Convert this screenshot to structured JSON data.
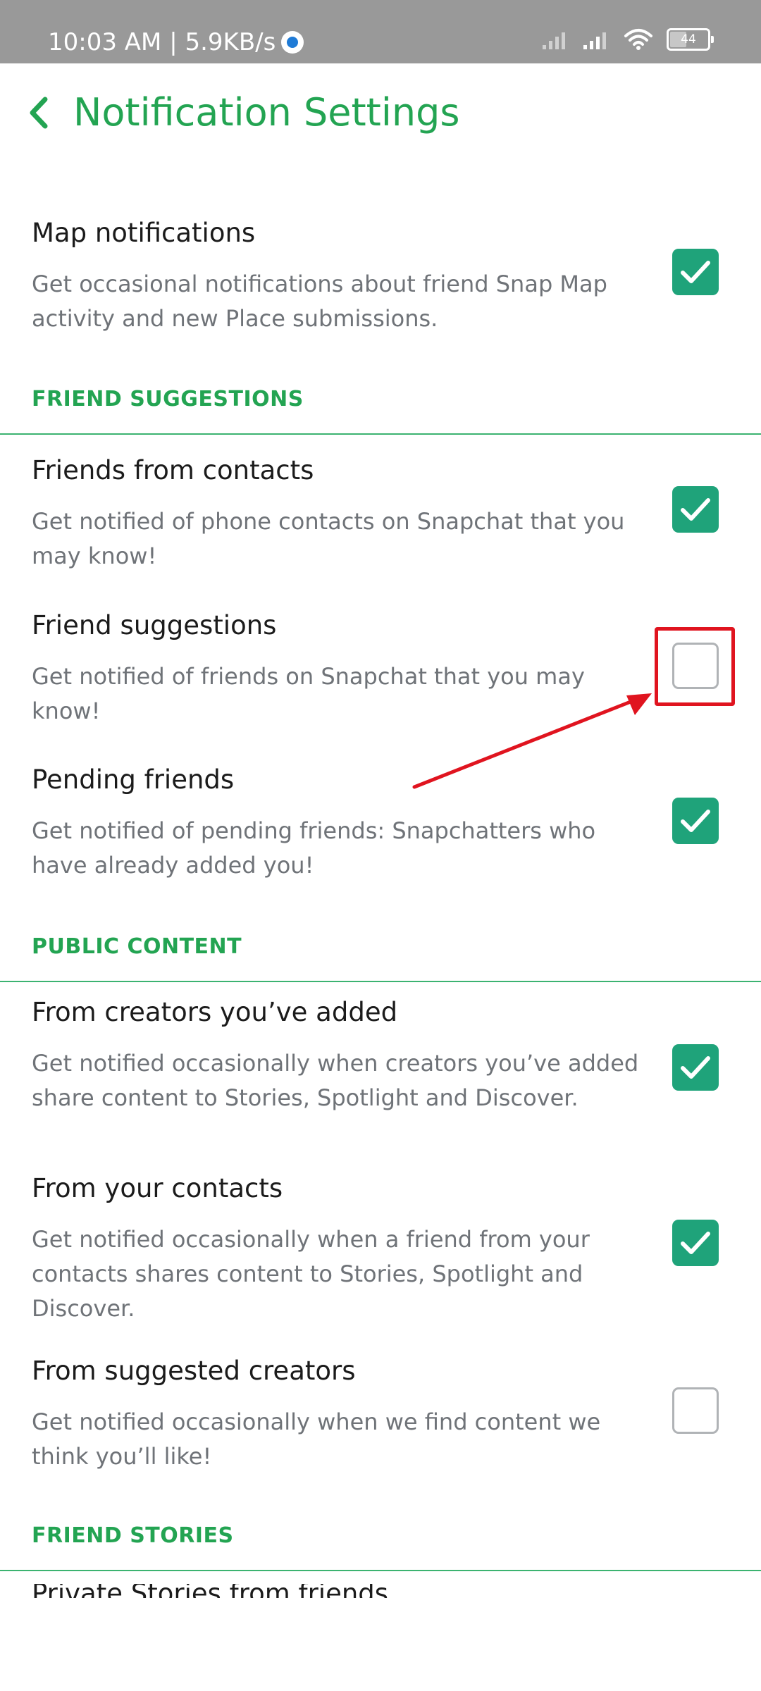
{
  "status_bar": {
    "time_speed": "10:03 AM | 5.9KB/s",
    "battery": "44",
    "battery_level": 0.44
  },
  "header": {
    "title": "Notification Settings"
  },
  "rows": {
    "map": {
      "title": "Map notifications",
      "desc": "Get occasional notifications about friend Snap Map activity and new Place submissions.",
      "checked": true
    },
    "friends_from_contacts": {
      "title": "Friends from contacts",
      "desc": "Get notified of phone contacts on Snapchat that you may know!",
      "checked": true
    },
    "friend_suggestions": {
      "title": "Friend suggestions",
      "desc": "Get notified of friends on Snapchat that you may know!",
      "checked": false
    },
    "pending_friends": {
      "title": "Pending friends",
      "desc": "Get notified of pending friends: Snapchatters who have already added you!",
      "checked": true
    },
    "from_creators_added": {
      "title": "From creators you’ve added",
      "desc": "Get notified occasionally when creators you’ve added share content to Stories, Spotlight and Discover.",
      "checked": true
    },
    "from_your_contacts": {
      "title": "From your contacts",
      "desc": "Get notified occasionally when a friend from your contacts shares content to Stories, Spotlight and Discover.",
      "checked": true
    },
    "from_suggested_creators": {
      "title": "From suggested creators",
      "desc": "Get notified occasionally when we find content we think you’ll like!",
      "checked": false
    },
    "private_stories": {
      "title": "Private Stories from friends"
    }
  },
  "sections": {
    "friend_suggestions": "FRIEND SUGGESTIONS",
    "public_content": "PUBLIC CONTENT",
    "friend_stories": "FRIEND STORIES"
  },
  "colors": {
    "accent_green": "#23a452",
    "checkbox_green": "#1fa37a",
    "annotation_red": "#e0141f",
    "status_bar_gray": "#999999"
  },
  "icons": {
    "back": "chevron-left-icon",
    "check": "checkmark-icon",
    "wifi": "wifi-icon",
    "signal": "signal-icon",
    "battery": "battery-icon",
    "data_saver": "data-saver-icon"
  }
}
